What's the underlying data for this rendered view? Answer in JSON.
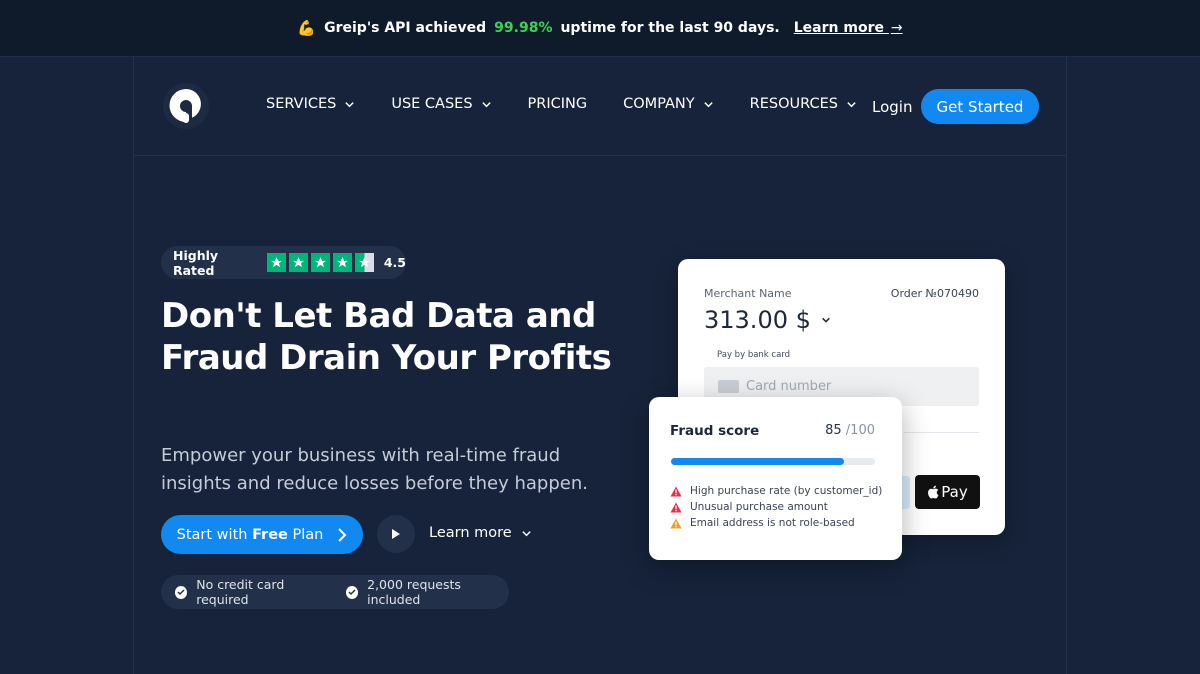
{
  "banner": {
    "emoji": "💪",
    "prefix": "Greip's API achieved",
    "uptime": "99.98%",
    "suffix": "uptime for the last 90 days.",
    "link": "Learn more",
    "arrow": "→"
  },
  "nav": {
    "items": [
      {
        "label": "SERVICES",
        "dropdown": true
      },
      {
        "label": "USE CASES",
        "dropdown": true
      },
      {
        "label": "PRICING",
        "dropdown": false
      },
      {
        "label": "COMPANY",
        "dropdown": true
      },
      {
        "label": "RESOURCES",
        "dropdown": true
      }
    ],
    "login": "Login",
    "cta": "Get Started"
  },
  "hero": {
    "rated_label": "Highly Rated",
    "rating": "4.5",
    "stars": 4.5,
    "title": "Don't Let Bad Data and Fraud Drain Your Profits",
    "subtitle": "Empower your business with real-time fraud insights and reduce losses before they happen.",
    "start_prefix": "Start with",
    "start_bold": "Free",
    "start_suffix": "Plan",
    "learn_more": "Learn more",
    "perks": [
      "No credit card required",
      "2,000 requests included"
    ]
  },
  "payment_card": {
    "merchant": "Merchant Name",
    "order": "Order №070490",
    "amount": "313.00 $",
    "pay_label": "Pay by bank card",
    "card_placeholder": "Card number",
    "apple_pay": "Pay"
  },
  "fraud_card": {
    "title": "Fraud score",
    "score": "85",
    "max": "/100",
    "score_fraction": 0.85,
    "flags": [
      {
        "text": "High purchase rate (by customer_id)",
        "color": "#e5324b"
      },
      {
        "text": "Unusual purchase amount",
        "color": "#e5324b"
      },
      {
        "text": "Email address is not role-based",
        "color": "#f39c24"
      }
    ]
  },
  "colors": {
    "background": "#16233a",
    "accent": "#1289f0",
    "uptime_green": "#39d353",
    "trustpilot_green": "#00b67a"
  }
}
